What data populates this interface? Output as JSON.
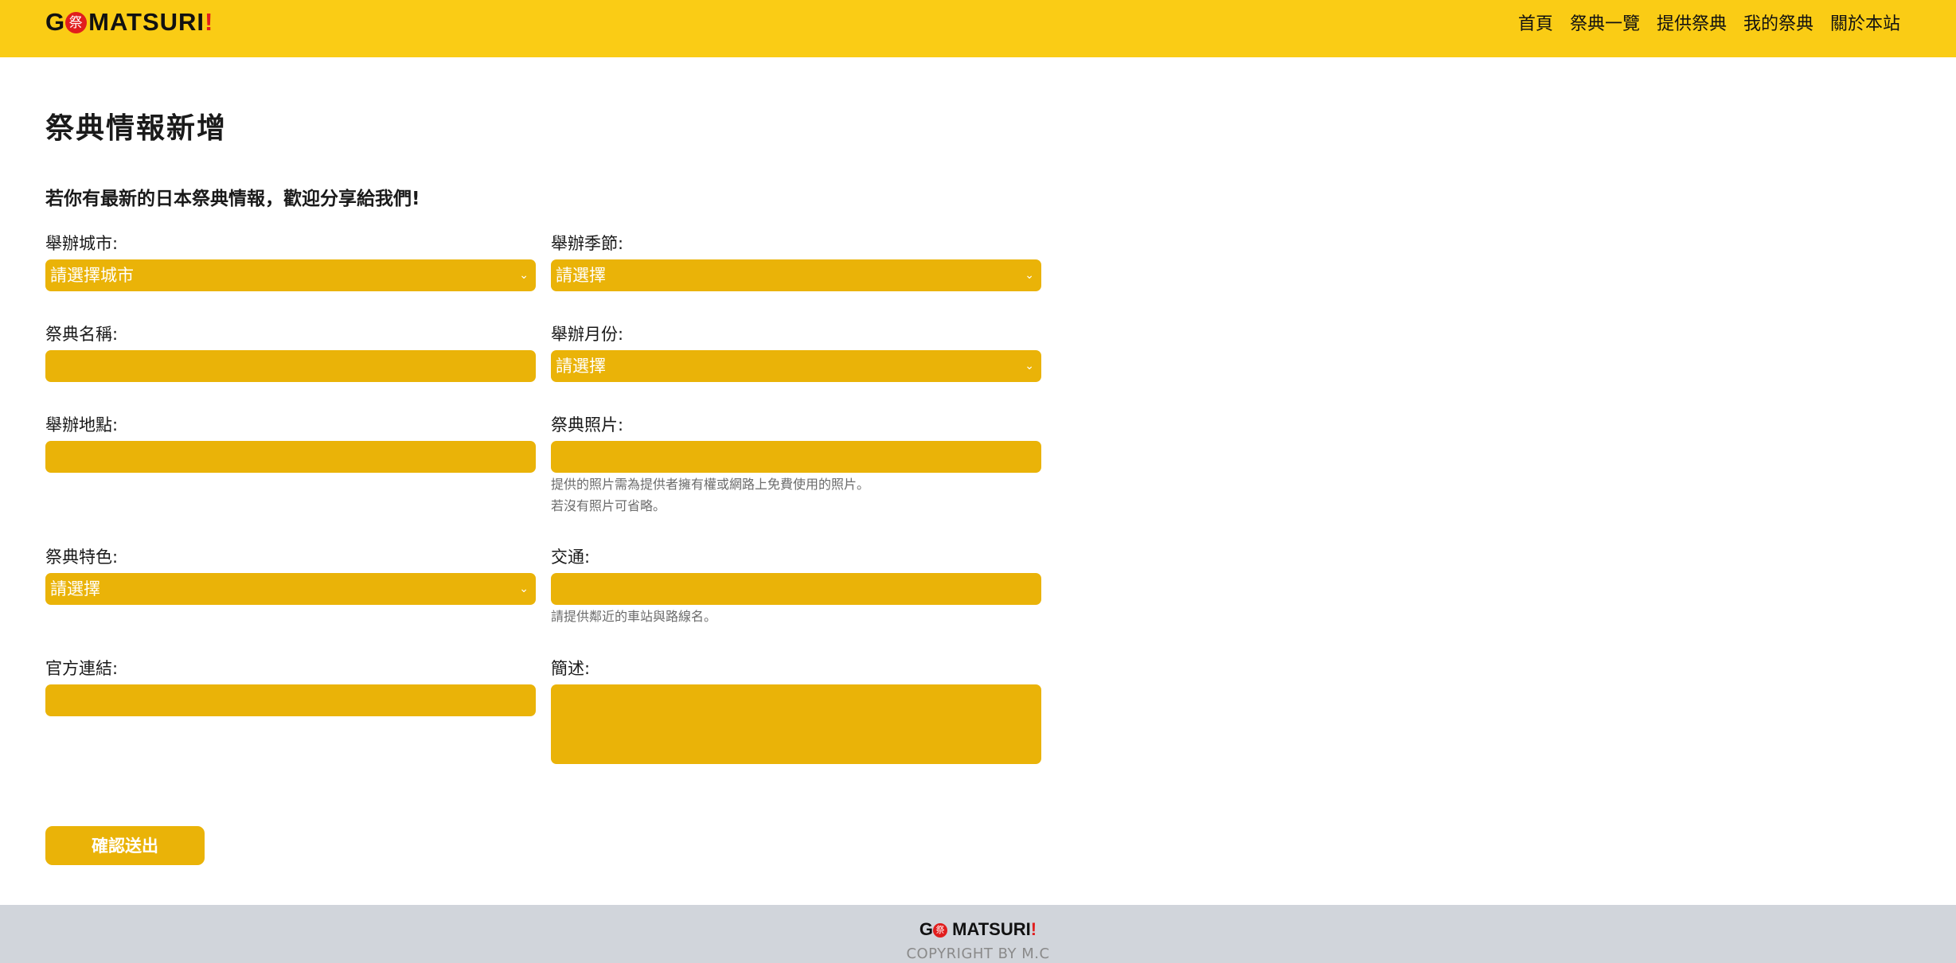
{
  "header": {
    "logo": {
      "prefix": "G",
      "seal": "祭",
      "name": "MATSURI",
      "excl": "!"
    },
    "nav": [
      "首頁",
      "祭典一覽",
      "提供祭典",
      "我的祭典",
      "關於本站"
    ]
  },
  "page": {
    "title": "祭典情報新增",
    "intro": "若你有最新的日本祭典情報，歡迎分享給我們!"
  },
  "form": {
    "city": {
      "label": "舉辦城市:",
      "value": "請選擇城市"
    },
    "season": {
      "label": "舉辦季節:",
      "value": "請選擇"
    },
    "name": {
      "label": "祭典名稱:",
      "value": ""
    },
    "month": {
      "label": "舉辦月份:",
      "value": "請選擇"
    },
    "location": {
      "label": "舉辦地點:",
      "value": ""
    },
    "photo": {
      "label": "祭典照片:",
      "value": "",
      "hint1": "提供的照片需為提供者擁有權或網路上免費使用的照片。",
      "hint2": "若沒有照片可省略。"
    },
    "feature": {
      "label": "祭典特色:",
      "value": "請選擇"
    },
    "transport": {
      "label": "交通:",
      "value": "",
      "hint": "請提供鄰近的車站與路線名。"
    },
    "link": {
      "label": "官方連結:",
      "value": ""
    },
    "summary": {
      "label": "簡述:",
      "value": ""
    },
    "submit": "確認送出"
  },
  "footer": {
    "logo": {
      "prefix": "G",
      "seal": "祭",
      "name": "MATSURI",
      "excl": "!"
    },
    "copyright": "COPYRIGHT BY M.C"
  },
  "colors": {
    "header_bg": "#facc15",
    "field_bg": "#eab308",
    "footer_bg": "#d1d5db",
    "accent_red": "#e11d1d"
  },
  "icons": {
    "select_arrow": "chevron-down-icon"
  }
}
